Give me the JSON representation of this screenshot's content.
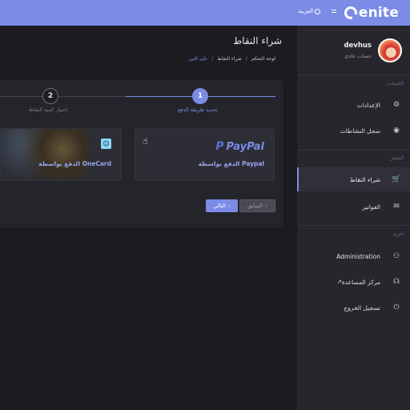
{
  "topbar": {
    "logo_text": "enite",
    "language_label": "العربية",
    "brand_color": "#7b8be6"
  },
  "main": {
    "page_title": "شراء النقاط",
    "breadcrumb": [
      "لوحة التحكم",
      "شراء النقاط",
      "عبّئ الثين"
    ],
    "steps": [
      {
        "number": "1",
        "label": "تحديد طريقة الدفع"
      },
      {
        "number": "2",
        "label": "إختيار كمية النقاط"
      }
    ],
    "payment_methods": [
      {
        "logo": "PayPal",
        "logo_mark": "P",
        "label": "الدفع بواسطة Paypal"
      },
      {
        "logo_icon": "onecard-icon",
        "label": "الدفع بواسطة OneCard"
      }
    ],
    "next_button": "التالي",
    "prev_button": "السابق"
  },
  "sidebar": {
    "username": "devhus",
    "role": "حساب عادي",
    "sections": [
      {
        "title": "الحساب",
        "items": [
          {
            "label": "الإعدادات",
            "icon": "gear-icon"
          },
          {
            "label": "سجل النشاطات",
            "icon": "eye-icon"
          }
        ]
      },
      {
        "title": "المتجر",
        "items": [
          {
            "label": "شراء النقاط",
            "icon": "cart-icon"
          },
          {
            "label": "الفواتير",
            "icon": "invoice-icon"
          }
        ]
      },
      {
        "title": "اخرى",
        "items": [
          {
            "label": "Administration",
            "icon": "admin-icon"
          },
          {
            "label": "مركز المساعدة",
            "icon": "support-icon"
          },
          {
            "label": "تسجيل الخروج",
            "icon": "power-icon"
          }
        ]
      }
    ]
  }
}
